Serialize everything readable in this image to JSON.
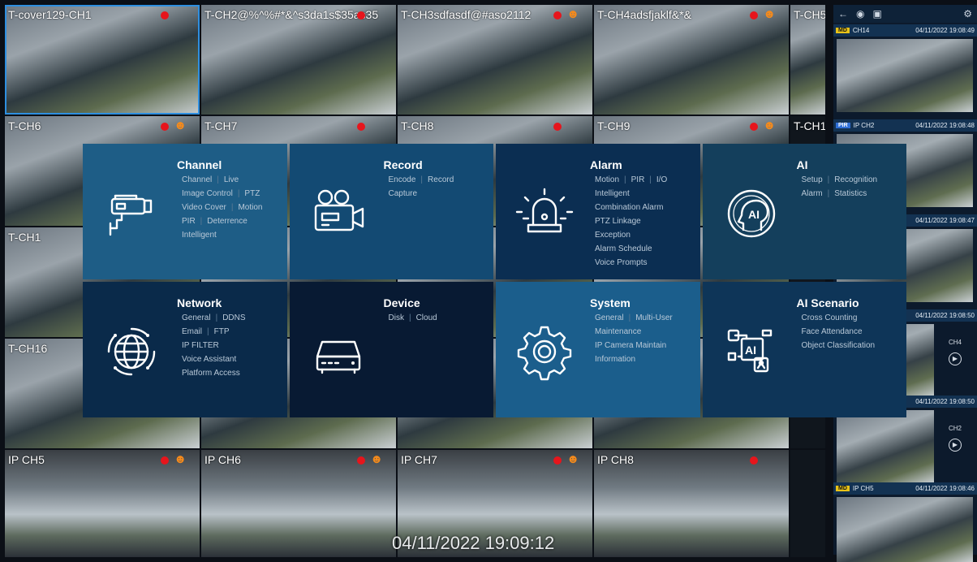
{
  "cameras": [
    {
      "title": "T-cover129-CH1",
      "rec": true,
      "motion": false
    },
    {
      "title": "T-CH2@%^%#*&^s3da1s$35as35",
      "rec": true,
      "motion": false
    },
    {
      "title": "T-CH3sdfasdf@#aso2112",
      "rec": true,
      "motion": true
    },
    {
      "title": "T-CH4adsfjaklf&*&",
      "rec": true,
      "motion": true
    },
    {
      "title": "T-CH5",
      "rec": false,
      "motion": false
    },
    {
      "title": "T-CH6",
      "rec": true,
      "motion": true
    },
    {
      "title": "T-CH7",
      "rec": true,
      "motion": false
    },
    {
      "title": "T-CH8",
      "rec": true,
      "motion": false
    },
    {
      "title": "T-CH9",
      "rec": true,
      "motion": true
    },
    {
      "title": "T-CH1",
      "rec": false,
      "motion": false
    },
    {
      "title": "T-CH1",
      "rec": false,
      "motion": false
    },
    {
      "title": "",
      "rec": false,
      "motion": false
    },
    {
      "title": "",
      "rec": false,
      "motion": false
    },
    {
      "title": "",
      "rec": false,
      "motion": false
    },
    {
      "title": "",
      "rec": false,
      "motion": false
    },
    {
      "title": "T-CH16",
      "rec": false,
      "motion": false
    },
    {
      "title": "",
      "rec": false,
      "motion": false
    },
    {
      "title": "",
      "rec": false,
      "motion": false
    },
    {
      "title": "",
      "rec": false,
      "motion": false
    },
    {
      "title": "",
      "rec": false,
      "motion": false
    },
    {
      "title": "IP CH5",
      "rec": true,
      "motion": true
    },
    {
      "title": "IP CH6",
      "rec": true,
      "motion": true
    },
    {
      "title": "IP CH7",
      "rec": true,
      "motion": true
    },
    {
      "title": "IP CH8",
      "rec": true,
      "motion": false
    },
    {
      "title": "",
      "rec": false,
      "motion": false
    }
  ],
  "timestamp": "04/11/2022 19:09:12",
  "right_panel": {
    "icons": [
      "back-icon",
      "eye-icon",
      "camera-icon",
      "settings-icon"
    ],
    "events": [
      {
        "badge": "MD",
        "channel": "CH14",
        "time": "04/11/2022 19:08:49",
        "side_label": "",
        "badge_color": "#e7c218"
      },
      {
        "badge": "PIR",
        "channel": "IP CH2",
        "time": "04/11/2022 19:08:48",
        "side_label": "",
        "badge_color": "#2f6fd6"
      },
      {
        "badge": "",
        "channel": "",
        "time": "04/11/2022 19:08:47",
        "side_label": "",
        "badge_color": ""
      },
      {
        "badge": "",
        "channel": "",
        "time": "04/11/2022 19:08:50",
        "side_label": "CH4",
        "badge_color": ""
      },
      {
        "badge": "",
        "channel": "",
        "time": "04/11/2022 19:08:50",
        "side_label": "CH2",
        "badge_color": ""
      },
      {
        "badge": "MD",
        "channel": "IP CH5",
        "time": "04/11/2022 19:08:46",
        "side_label": "",
        "badge_color": "#e7c218"
      }
    ]
  },
  "menu": [
    {
      "title": "Channel",
      "icon": "cctv-camera-icon",
      "color": "#1e5d86",
      "rows": [
        [
          "Channel",
          "Live"
        ],
        [
          "Image Control",
          "PTZ"
        ],
        [
          "Video Cover",
          "Motion"
        ],
        [
          "PIR",
          "Deterrence"
        ],
        [
          "Intelligent"
        ]
      ]
    },
    {
      "title": "Record",
      "icon": "video-camera-icon",
      "color": "#134a73",
      "rows": [
        [
          "Encode",
          "Record"
        ],
        [
          "Capture"
        ]
      ]
    },
    {
      "title": "Alarm",
      "icon": "alarm-siren-icon",
      "color": "#0b2e52",
      "rows": [
        [
          "Motion",
          "PIR",
          "I/O"
        ],
        [
          "Intelligent"
        ],
        [
          "Combination Alarm"
        ],
        [
          "PTZ Linkage"
        ],
        [
          "Exception"
        ],
        [
          "Alarm Schedule"
        ],
        [
          "Voice Prompts"
        ]
      ]
    },
    {
      "title": "AI",
      "icon": "ai-head-icon",
      "color": "#143f5c",
      "rows": [
        [
          "Setup",
          "Recognition"
        ],
        [
          "Alarm",
          "Statistics"
        ]
      ]
    },
    {
      "title": "Network",
      "icon": "globe-icon",
      "color": "#0a2a4a",
      "rows": [
        [
          "General",
          "DDNS"
        ],
        [
          "Email",
          "FTP"
        ],
        [
          "IP FILTER"
        ],
        [
          "Voice Assistant"
        ],
        [
          "Platform Access"
        ]
      ]
    },
    {
      "title": "Device",
      "icon": "hard-disk-icon",
      "color": "#081a33",
      "rows": [
        [
          "Disk",
          "Cloud"
        ]
      ]
    },
    {
      "title": "System",
      "icon": "gear-icon",
      "color": "#1b5e8c",
      "rows": [
        [
          "General",
          "Multi-User"
        ],
        [
          "Maintenance"
        ],
        [
          "IP Camera Maintain"
        ],
        [
          "Information"
        ]
      ]
    },
    {
      "title": "AI Scenario",
      "icon": "ai-scenario-icon",
      "color": "#0e3558",
      "rows": [
        [
          "Cross Counting"
        ],
        [
          "Face Attendance"
        ],
        [
          "Object Classification"
        ]
      ]
    }
  ]
}
